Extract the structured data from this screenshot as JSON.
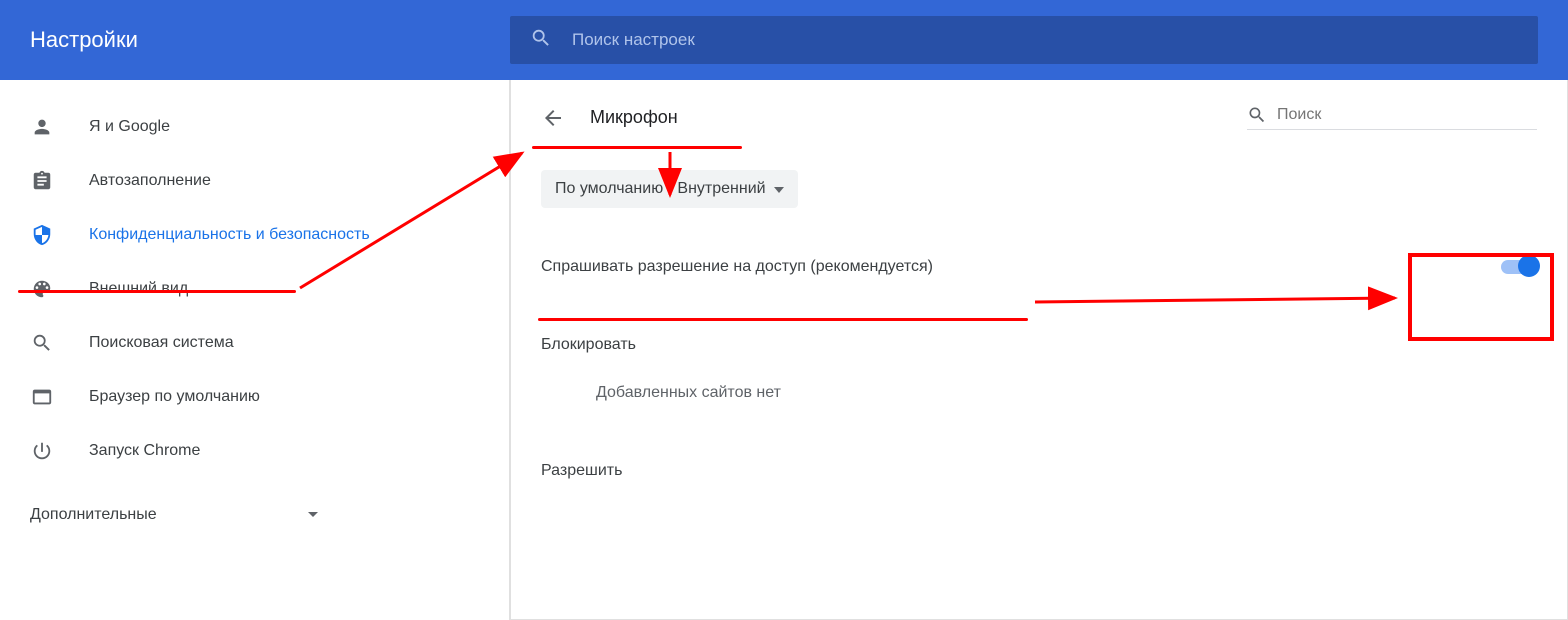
{
  "header": {
    "title": "Настройки",
    "search_placeholder": "Поиск настроек"
  },
  "sidebar": {
    "items": [
      {
        "label": "Я и Google",
        "icon": "person"
      },
      {
        "label": "Автозаполнение",
        "icon": "clipboard"
      },
      {
        "label": "Конфиденциальность и безопасность",
        "icon": "shield"
      },
      {
        "label": "Внешний вид",
        "icon": "palette"
      },
      {
        "label": "Поисковая система",
        "icon": "search"
      },
      {
        "label": "Браузер по умолчанию",
        "icon": "browser"
      },
      {
        "label": "Запуск Chrome",
        "icon": "power"
      }
    ],
    "expand_label": "Дополнительные"
  },
  "main": {
    "page_title": "Микрофон",
    "search_placeholder": "Поиск",
    "dropdown_label": "По умолчанию - Внутренний",
    "toggle_label": "Спрашивать разрешение на доступ (рекомендуется)",
    "block_heading": "Блокировать",
    "block_empty": "Добавленных сайтов нет",
    "allow_heading": "Разрешить"
  }
}
